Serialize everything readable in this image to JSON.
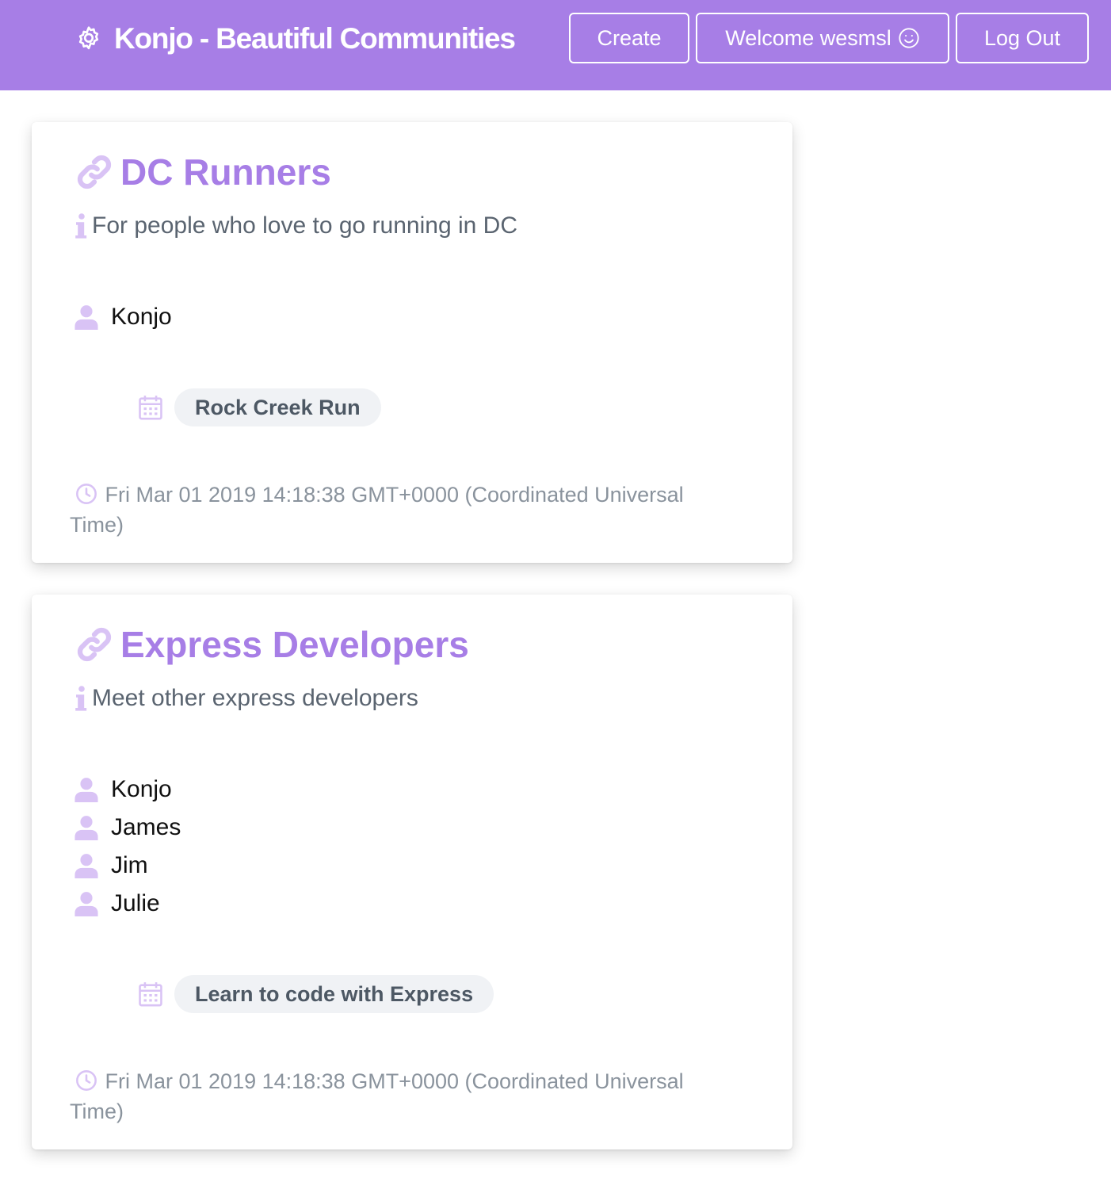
{
  "navbar": {
    "brand": "Konjo - Beautiful Communities",
    "brand_icon": "gear-icon",
    "create_label": "Create",
    "welcome_label": "Welcome wesmsl",
    "welcome_icon": "smile-icon",
    "logout_label": "Log Out",
    "background_color": "#a77ee6"
  },
  "communities": [
    {
      "title": "DC Runners",
      "title_icon": "link-icon",
      "description": "For people who love to go running in DC",
      "description_icon": "info-icon",
      "members": [
        "Konjo"
      ],
      "member_icon": "user-icon",
      "events": [
        "Rock Creek Run"
      ],
      "event_icon": "calendar-icon",
      "created": "Fri Mar 01 2019 14:18:38 GMT+0000 (Coordinated Universal Time)",
      "created_icon": "clock-icon"
    },
    {
      "title": "Express Developers",
      "title_icon": "link-icon",
      "description": "Meet other express developers",
      "description_icon": "info-icon",
      "members": [
        "Konjo",
        "James",
        "Jim",
        "Julie"
      ],
      "member_icon": "user-icon",
      "events": [
        "Learn to code with Express"
      ],
      "event_icon": "calendar-icon",
      "created": "Fri Mar 01 2019 14:18:38 GMT+0000 (Coordinated Universal Time)",
      "created_icon": "clock-icon"
    }
  ],
  "colors": {
    "accent": "#a77ee6",
    "icon_light": "#d9c3f5",
    "text_muted": "#8a939d",
    "pill_bg": "#f0f2f5"
  }
}
